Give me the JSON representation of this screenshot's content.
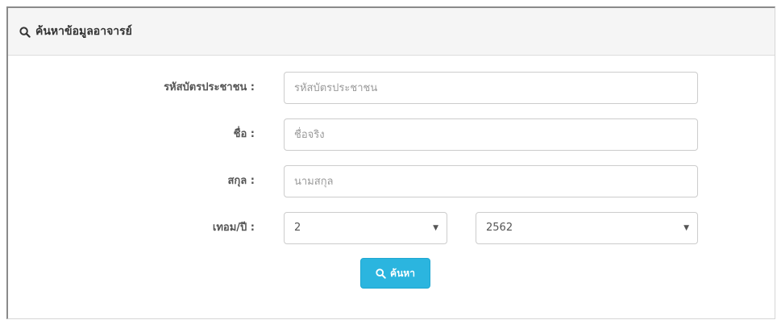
{
  "panel": {
    "title": "ค้นหาข้อมูลอาจารย์",
    "title_icon": "search-icon"
  },
  "form": {
    "id_card": {
      "label": "รหัสบัตรประชาชน :",
      "placeholder": "รหัสบัตรประชาชน",
      "value": ""
    },
    "first_name": {
      "label": "ชื่อ :",
      "placeholder": "ชื่อจริง",
      "value": ""
    },
    "last_name": {
      "label": "สกุล :",
      "placeholder": "นามสกุล",
      "value": ""
    },
    "term_year": {
      "label": "เทอม/ปี :",
      "term_selected": "2",
      "year_selected": "2562",
      "arrow_icon": "caret-down-icon"
    }
  },
  "search_button": {
    "label": "ค้นหา",
    "icon": "search-icon",
    "color": "#2bb5df"
  }
}
